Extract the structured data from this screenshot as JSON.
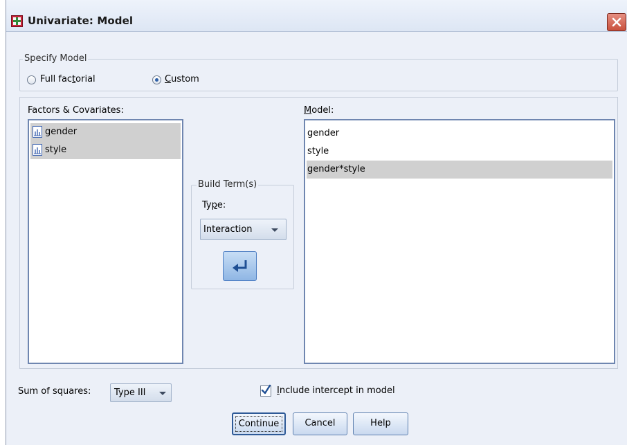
{
  "window": {
    "title": "Univariate: Model"
  },
  "specify_model": {
    "legend": "Specify Model",
    "full_factorial": {
      "pre": "Full fac",
      "mn": "t",
      "post": "orial",
      "checked": false
    },
    "custom": {
      "mn": "C",
      "post": "ustom",
      "checked": true
    }
  },
  "factors": {
    "label": "Factors & Covariates:",
    "items": [
      "gender",
      "style"
    ]
  },
  "build_terms": {
    "legend": "Build Term(s)",
    "type_label": {
      "pre": "Ty",
      "mn": "p",
      "post": "e:"
    },
    "type_value": "Interaction"
  },
  "model": {
    "label": {
      "mn": "M",
      "post": "odel:"
    },
    "items": [
      "gender",
      "style",
      "gender*style"
    ],
    "selected_index": 2
  },
  "bottom": {
    "sum_squares_label": "Sum of squares:",
    "sum_squares_value": "Type III",
    "intercept": {
      "mn": "I",
      "post": "nclude intercept in model",
      "checked": true
    }
  },
  "buttons": {
    "continue": "Continue",
    "cancel": "Cancel",
    "help": "Help"
  },
  "colors": {
    "accent": "#2d5fa8",
    "selection": "#d0d0d0",
    "list_border": "#6f86b0"
  }
}
